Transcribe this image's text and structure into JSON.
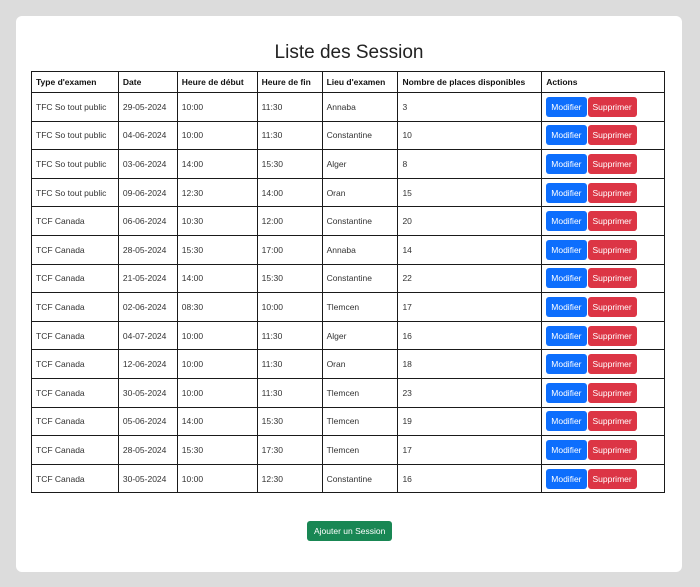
{
  "page": {
    "title": "Liste des Session"
  },
  "table": {
    "headers": [
      "Type d'examen",
      "Date",
      "Heure de début",
      "Heure de fin",
      "Lieu d'examen",
      "Nombre de places disponibles",
      "Actions"
    ],
    "edit_label": "Modifier",
    "delete_label": "Supprimer",
    "rows": [
      [
        "TFC So tout public",
        "29-05-2024",
        "10:00",
        "11:30",
        "Annaba",
        "3"
      ],
      [
        "TFC So tout public",
        "04-06-2024",
        "10:00",
        "11:30",
        "Constantine",
        "10"
      ],
      [
        "TFC So tout public",
        "03-06-2024",
        "14:00",
        "15:30",
        "Alger",
        "8"
      ],
      [
        "TFC So tout public",
        "09-06-2024",
        "12:30",
        "14:00",
        "Oran",
        "15"
      ],
      [
        "TCF Canada",
        "06-06-2024",
        "10:30",
        "12:00",
        "Constantine",
        "20"
      ],
      [
        "TCF Canada",
        "28-05-2024",
        "15:30",
        "17:00",
        "Annaba",
        "14"
      ],
      [
        "TCF Canada",
        "21-05-2024",
        "14:00",
        "15:30",
        "Constantine",
        "22"
      ],
      [
        "TCF Canada",
        "02-06-2024",
        "08:30",
        "10:00",
        "Tlemcen",
        "17"
      ],
      [
        "TCF Canada",
        "04-07-2024",
        "10:00",
        "11:30",
        "Alger",
        "16"
      ],
      [
        "TCF Canada",
        "12-06-2024",
        "10:00",
        "11:30",
        "Oran",
        "18"
      ],
      [
        "TCF Canada",
        "30-05-2024",
        "10:00",
        "11:30",
        "Tlemcen",
        "23"
      ],
      [
        "TCF Canada",
        "05-06-2024",
        "14:00",
        "15:30",
        "Tlemcen",
        "19"
      ],
      [
        "TCF Canada",
        "28-05-2024",
        "15:30",
        "17:30",
        "Tlemcen",
        "17"
      ],
      [
        "TCF Canada",
        "30-05-2024",
        "10:00",
        "12:30",
        "Constantine",
        "16"
      ]
    ]
  },
  "add_button": {
    "label": "Ajouter un Session"
  },
  "colors": {
    "edit": "#0d6efd",
    "delete": "#dc3545",
    "add": "#198754"
  }
}
